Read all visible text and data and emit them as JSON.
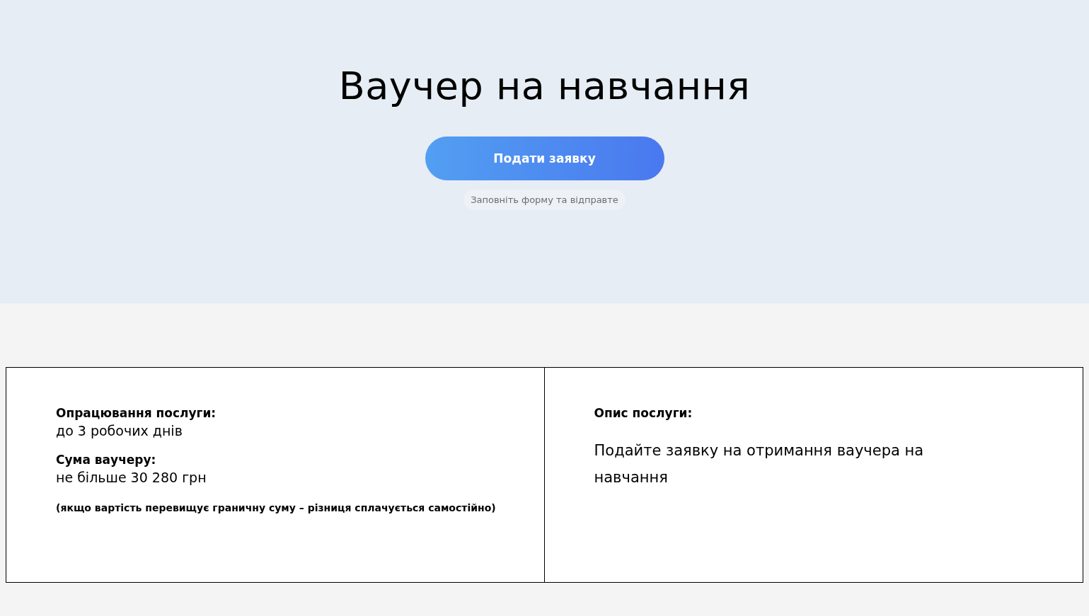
{
  "hero": {
    "title": "Ваучер на навчання",
    "apply_button": "Подати заявку",
    "hint": "Заповніть форму та відправте"
  },
  "details": {
    "facts": [
      {
        "label": "Опрацювання послуги:",
        "value": "до 3 робочих днів"
      },
      {
        "label": "Сума ваучеру:",
        "value": "не більше 30 280 грн"
      }
    ],
    "note": "(якщо вартість перевищує граничну суму – різниця сплачується самостійно)",
    "description": {
      "label": "Опис послуги:",
      "text": "Подайте заявку на отримання ваучера на навчання"
    }
  }
}
